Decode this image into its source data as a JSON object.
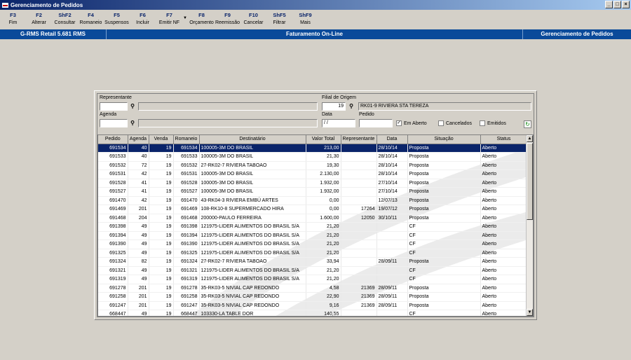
{
  "window": {
    "title": "Gerenciamento de Pedidos",
    "buttons": [
      "_",
      "□",
      "×"
    ]
  },
  "toolbar": [
    {
      "key": "F3",
      "label": "Fim"
    },
    {
      "key": "F2",
      "label": "Alterar"
    },
    {
      "key": "ShF2",
      "label": "Consultar"
    },
    {
      "key": "F4",
      "label": "Romaneio"
    },
    {
      "key": "F5",
      "label": "Suspensos"
    },
    {
      "key": "F6",
      "label": "Incluir"
    },
    {
      "key": "F7",
      "label": "Emitir NF"
    },
    {
      "key": "F8",
      "label": "Orçamento"
    },
    {
      "key": "F9",
      "label": "Reemissão"
    },
    {
      "key": "F10",
      "label": "Cancelar"
    },
    {
      "key": "ShF5",
      "label": "Filtrar"
    },
    {
      "key": "ShF9",
      "label": "Mais"
    }
  ],
  "status": {
    "left": "G-RMS Retail 5.681 RMS",
    "center": "Faturamento On-Line",
    "right": "Gerenciamento de Pedidos"
  },
  "filters": {
    "representante_label": "Representante",
    "representante_code": "",
    "representante_name": "",
    "filial_label": "Filial de Origem",
    "filial_code": "19",
    "filial_name": "RK01-9 RIVIERA STA TEREZA",
    "agenda_label": "Agenda",
    "agenda_code": "",
    "agenda_name": "",
    "data_label": "Data",
    "data_value": " / /",
    "pedido_label": "Pedido",
    "pedido_value": "",
    "em_aberto": "Em Aberto",
    "cancelados": "Cancelados",
    "emitidos": "Emitidos"
  },
  "grid": {
    "columns": [
      "Pedido",
      "Agenda",
      "Venda",
      "Romaneio",
      "Destinatário",
      "Valor Total",
      "Representante",
      "Data",
      "Situação",
      "Status"
    ],
    "rows": [
      [
        "691534",
        "40",
        "19",
        "691534",
        "100005-3M DO BRASIL",
        "213,00",
        "",
        "28/10/14",
        "Proposta",
        "Aberto"
      ],
      [
        "691533",
        "40",
        "19",
        "691533",
        "100005-3M DO BRASIL",
        "21,30",
        "",
        "28/10/14",
        "Proposta",
        "Aberto"
      ],
      [
        "691532",
        "72",
        "19",
        "691532",
        "27-RK02-7 RIVIERA TABOAO",
        "19,30",
        "",
        "28/10/14",
        "Proposta",
        "Aberto"
      ],
      [
        "691531",
        "42",
        "19",
        "691531",
        "100005-3M DO BRASIL",
        "2.130,00",
        "",
        "28/10/14",
        "Proposta",
        "Aberto"
      ],
      [
        "691528",
        "41",
        "19",
        "691528",
        "100005-3M DO BRASIL",
        "1.932,00",
        "",
        "27/10/14",
        "Proposta",
        "Aberto"
      ],
      [
        "691527",
        "41",
        "19",
        "691527",
        "100005-3M DO BRASIL",
        "1.932,00",
        "",
        "27/10/14",
        "Proposta",
        "Aberto"
      ],
      [
        "691470",
        "42",
        "19",
        "691470",
        "43-RK04-3 RIVIERA EMBÚ ARTES",
        "0,00",
        "",
        "12/07/13",
        "Proposta",
        "Aberto"
      ],
      [
        "691469",
        "201",
        "19",
        "691469",
        "108-RK10-8 SUPERMERCADO HIRA",
        "0,00",
        "17264",
        "19/07/12",
        "Proposta",
        "Aberto"
      ],
      [
        "691468",
        "204",
        "19",
        "691468",
        "200000-PAULO FERREIRA",
        "1.600,00",
        "12050",
        "30/10/11",
        "Proposta",
        "Aberto"
      ],
      [
        "691398",
        "49",
        "19",
        "691398",
        "121975-LIDER ALIMENTOS DO BRASIL S/A",
        "21,20",
        "",
        "",
        "CF",
        "Aberto"
      ],
      [
        "691394",
        "49",
        "19",
        "691394",
        "121975-LIDER ALIMENTOS DO BRASIL S/A",
        "21,20",
        "",
        "",
        "CF",
        "Aberto"
      ],
      [
        "691390",
        "49",
        "19",
        "691390",
        "121975-LIDER ALIMENTOS DO BRASIL S/A",
        "21,20",
        "",
        "",
        "CF",
        "Aberto"
      ],
      [
        "691325",
        "49",
        "19",
        "691325",
        "121975-LIDER ALIMENTOS DO BRASIL S/A",
        "21,20",
        "",
        "",
        "CF",
        "Aberto"
      ],
      [
        "691324",
        "82",
        "19",
        "691324",
        "27-RK02-7 RIVIERA TABOAO",
        "33,94",
        "",
        "28/09/11",
        "Proposta",
        "Aberto"
      ],
      [
        "691321",
        "49",
        "19",
        "691321",
        "121975-LIDER ALIMENTOS DO BRASIL S/A",
        "21,20",
        "",
        "",
        "CF",
        "Aberto"
      ],
      [
        "691319",
        "49",
        "19",
        "691319",
        "121975-LIDER ALIMENTOS DO BRASIL S/A",
        "21,20",
        "",
        "",
        "CF",
        "Aberto"
      ],
      [
        "691278",
        "201",
        "19",
        "691278",
        "35-RK03-5 NIVIAL CAP REDONDO",
        "4,58",
        "21369",
        "28/09/11",
        "Proposta",
        "Aberto"
      ],
      [
        "691258",
        "201",
        "19",
        "691258",
        "35-RK03-5 NIVIAL CAP REDONDO",
        "22,90",
        "21369",
        "28/09/11",
        "Proposta",
        "Aberto"
      ],
      [
        "691247",
        "201",
        "19",
        "691247",
        "35-RK03-5 NIVIAL CAP REDONDO",
        "9,16",
        "21369",
        "28/09/11",
        "Proposta",
        "Aberto"
      ],
      [
        "668447",
        "49",
        "19",
        "668447",
        "103330-LA TABLE DOR",
        "140,55",
        "",
        "",
        "CF",
        "Aberto"
      ]
    ]
  }
}
